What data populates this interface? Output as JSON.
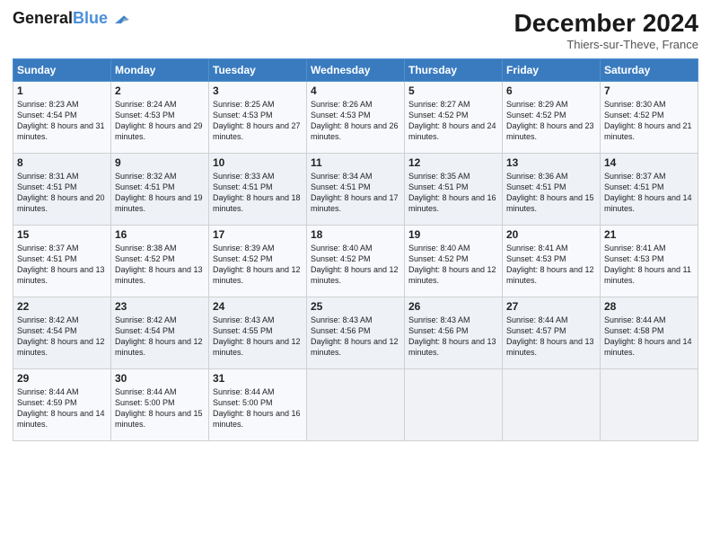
{
  "header": {
    "logo_line1": "General",
    "logo_line2": "Blue",
    "month": "December 2024",
    "location": "Thiers-sur-Theve, France"
  },
  "weekdays": [
    "Sunday",
    "Monday",
    "Tuesday",
    "Wednesday",
    "Thursday",
    "Friday",
    "Saturday"
  ],
  "weeks": [
    [
      {
        "day": "1",
        "sunrise": "8:23 AM",
        "sunset": "4:54 PM",
        "daylight": "8 hours and 31 minutes."
      },
      {
        "day": "2",
        "sunrise": "8:24 AM",
        "sunset": "4:53 PM",
        "daylight": "8 hours and 29 minutes."
      },
      {
        "day": "3",
        "sunrise": "8:25 AM",
        "sunset": "4:53 PM",
        "daylight": "8 hours and 27 minutes."
      },
      {
        "day": "4",
        "sunrise": "8:26 AM",
        "sunset": "4:53 PM",
        "daylight": "8 hours and 26 minutes."
      },
      {
        "day": "5",
        "sunrise": "8:27 AM",
        "sunset": "4:52 PM",
        "daylight": "8 hours and 24 minutes."
      },
      {
        "day": "6",
        "sunrise": "8:29 AM",
        "sunset": "4:52 PM",
        "daylight": "8 hours and 23 minutes."
      },
      {
        "day": "7",
        "sunrise": "8:30 AM",
        "sunset": "4:52 PM",
        "daylight": "8 hours and 21 minutes."
      }
    ],
    [
      {
        "day": "8",
        "sunrise": "8:31 AM",
        "sunset": "4:51 PM",
        "daylight": "8 hours and 20 minutes."
      },
      {
        "day": "9",
        "sunrise": "8:32 AM",
        "sunset": "4:51 PM",
        "daylight": "8 hours and 19 minutes."
      },
      {
        "day": "10",
        "sunrise": "8:33 AM",
        "sunset": "4:51 PM",
        "daylight": "8 hours and 18 minutes."
      },
      {
        "day": "11",
        "sunrise": "8:34 AM",
        "sunset": "4:51 PM",
        "daylight": "8 hours and 17 minutes."
      },
      {
        "day": "12",
        "sunrise": "8:35 AM",
        "sunset": "4:51 PM",
        "daylight": "8 hours and 16 minutes."
      },
      {
        "day": "13",
        "sunrise": "8:36 AM",
        "sunset": "4:51 PM",
        "daylight": "8 hours and 15 minutes."
      },
      {
        "day": "14",
        "sunrise": "8:37 AM",
        "sunset": "4:51 PM",
        "daylight": "8 hours and 14 minutes."
      }
    ],
    [
      {
        "day": "15",
        "sunrise": "8:37 AM",
        "sunset": "4:51 PM",
        "daylight": "8 hours and 13 minutes."
      },
      {
        "day": "16",
        "sunrise": "8:38 AM",
        "sunset": "4:52 PM",
        "daylight": "8 hours and 13 minutes."
      },
      {
        "day": "17",
        "sunrise": "8:39 AM",
        "sunset": "4:52 PM",
        "daylight": "8 hours and 12 minutes."
      },
      {
        "day": "18",
        "sunrise": "8:40 AM",
        "sunset": "4:52 PM",
        "daylight": "8 hours and 12 minutes."
      },
      {
        "day": "19",
        "sunrise": "8:40 AM",
        "sunset": "4:52 PM",
        "daylight": "8 hours and 12 minutes."
      },
      {
        "day": "20",
        "sunrise": "8:41 AM",
        "sunset": "4:53 PM",
        "daylight": "8 hours and 12 minutes."
      },
      {
        "day": "21",
        "sunrise": "8:41 AM",
        "sunset": "4:53 PM",
        "daylight": "8 hours and 11 minutes."
      }
    ],
    [
      {
        "day": "22",
        "sunrise": "8:42 AM",
        "sunset": "4:54 PM",
        "daylight": "8 hours and 12 minutes."
      },
      {
        "day": "23",
        "sunrise": "8:42 AM",
        "sunset": "4:54 PM",
        "daylight": "8 hours and 12 minutes."
      },
      {
        "day": "24",
        "sunrise": "8:43 AM",
        "sunset": "4:55 PM",
        "daylight": "8 hours and 12 minutes."
      },
      {
        "day": "25",
        "sunrise": "8:43 AM",
        "sunset": "4:56 PM",
        "daylight": "8 hours and 12 minutes."
      },
      {
        "day": "26",
        "sunrise": "8:43 AM",
        "sunset": "4:56 PM",
        "daylight": "8 hours and 13 minutes."
      },
      {
        "day": "27",
        "sunrise": "8:44 AM",
        "sunset": "4:57 PM",
        "daylight": "8 hours and 13 minutes."
      },
      {
        "day": "28",
        "sunrise": "8:44 AM",
        "sunset": "4:58 PM",
        "daylight": "8 hours and 14 minutes."
      }
    ],
    [
      {
        "day": "29",
        "sunrise": "8:44 AM",
        "sunset": "4:59 PM",
        "daylight": "8 hours and 14 minutes."
      },
      {
        "day": "30",
        "sunrise": "8:44 AM",
        "sunset": "5:00 PM",
        "daylight": "8 hours and 15 minutes."
      },
      {
        "day": "31",
        "sunrise": "8:44 AM",
        "sunset": "5:00 PM",
        "daylight": "8 hours and 16 minutes."
      },
      null,
      null,
      null,
      null
    ]
  ]
}
